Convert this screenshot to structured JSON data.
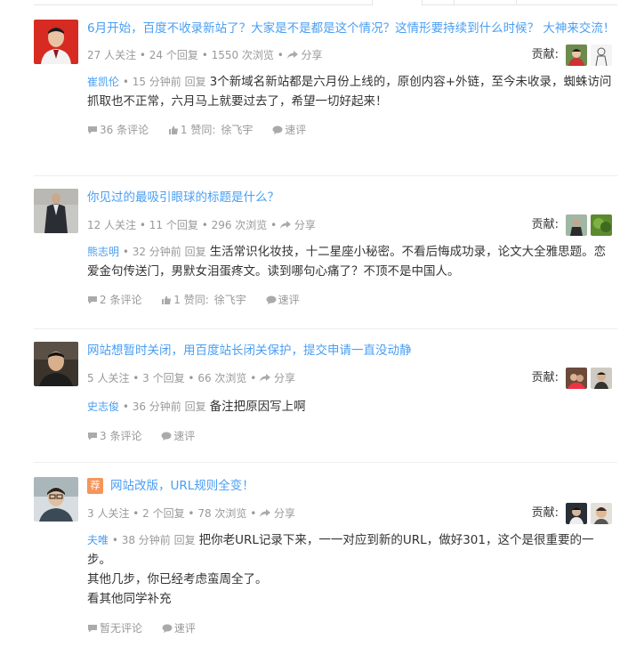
{
  "labels": {
    "contribute": "贡献:",
    "share": "分享",
    "quick_review": "速评",
    "upvote_prefix": "1 赞同:"
  },
  "colors": {
    "link": "#499ef3",
    "muted": "#999999",
    "recommend_badge": "#f5955b"
  },
  "questions": [
    {
      "title": "6月开始，百度不收录新站了？大家是不是都是这个情况？这情形要持续到什么时候？ 大神来交流！",
      "meta": "27 人关注 • 24 个回复 • 1550 次浏览 • ",
      "answer_user": "崔凯伦",
      "answer_time": " • 15 分钟前 回复",
      "answer_text": "3个新域名新站都是六月份上线的，原创内容+外链，至今未收录，蜘蛛访问抓取也不正常，六月马上就要过去了，希望一切好起来！",
      "comments": "36 条评论",
      "upvote": "1 赞同:",
      "voter": "徐飞宇"
    },
    {
      "title": "你见过的最吸引眼球的标题是什么？",
      "meta": "12 人关注 • 11 个回复 • 296 次浏览 • ",
      "answer_user": "熊志明",
      "answer_time": " • 32 分钟前 回复",
      "answer_text": "生活常识化妆技，十二星座小秘密。不看后悔成功录，论文大全雅思题。恋爱金句传送门，男默女泪蛋疼文。读到哪句心痛了？不顶不是中国人。",
      "comments": "2 条评论",
      "upvote": "1 赞同:",
      "voter": "徐飞宇"
    },
    {
      "title": "网站想暂时关闭，用百度站长闭关保护，提交申请一直没动静",
      "meta": "5 人关注 • 3 个回复 • 66 次浏览 • ",
      "answer_user": "史志俊",
      "answer_time": " • 36 分钟前 回复",
      "answer_text": "备注把原因写上啊",
      "comments": "3 条评论"
    },
    {
      "badge": "荐",
      "title": "网站改版，URL规则全变！",
      "meta": "3 人关注 • 2 个回复 • 78 次浏览 • ",
      "answer_user": "夫唯",
      "answer_time": " • 38 分钟前 回复",
      "answer_text": "把你老URL记录下来，一一对应到新的URL，做好301，这个是很重要的一步。",
      "answer_line2": "其他几步，你已经考虑蛮周全了。",
      "answer_line3": "看其他同学补充",
      "comments": "暂无评论"
    }
  ]
}
